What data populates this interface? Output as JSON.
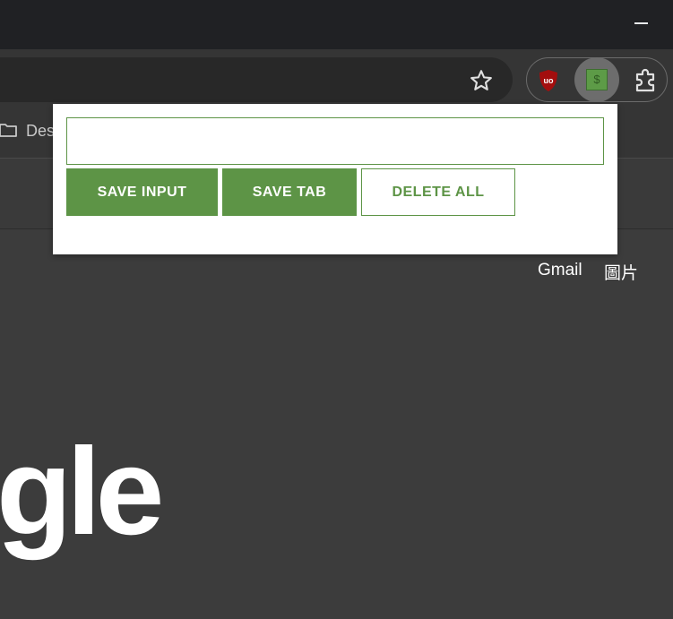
{
  "browser": {
    "minimize_glyph": "—",
    "omnibox": {
      "bookmark_star": "star-outline-icon"
    },
    "extensions": {
      "ublock": {
        "glyph": "uo",
        "color": "#a30e0e"
      },
      "active_extension": {
        "glyph": "$",
        "color": "#5d9b47"
      },
      "extensions_menu": "puzzle-icon"
    },
    "bookmarks_bar": {
      "items": [
        {
          "icon": "folder-icon",
          "label": "Des"
        }
      ]
    }
  },
  "page": {
    "links": {
      "gmail": "Gmail",
      "images": "圖片"
    },
    "logo_fragment": "gle"
  },
  "popup": {
    "input": {
      "value": "",
      "placeholder": ""
    },
    "buttons": {
      "save_input": "SAVE INPUT",
      "save_tab": "SAVE TAB",
      "delete_all": "DELETE ALL"
    },
    "accent_color": "#5d9446"
  }
}
